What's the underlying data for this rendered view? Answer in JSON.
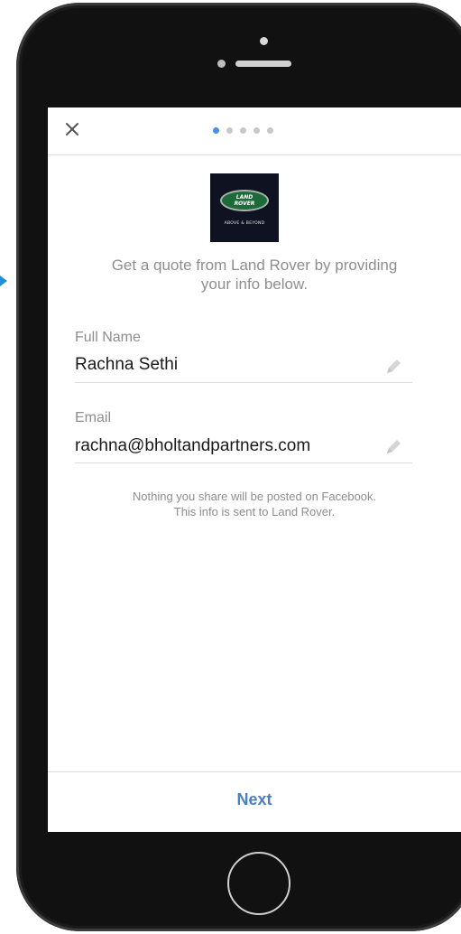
{
  "form": {
    "logo_alt": "LAND ROVER",
    "logo_wordmark_line1": "LAND",
    "logo_wordmark_line2": "ROVER",
    "logo_tagline": "ABOVE & BEYOND",
    "intro_line1": "Get a quote from Land Rover by providing",
    "intro_line2": "your info below.",
    "fields": [
      {
        "label": "Full Name",
        "value": "Rachna Sethi"
      },
      {
        "label": "Email",
        "value": "rachna@bholtandpartners.com"
      }
    ],
    "privacy_line1": "Nothing you share will be posted on Facebook.",
    "privacy_line2": "This info is sent to Land Rover.",
    "next_label": "Next"
  },
  "progress": {
    "total_steps": 5,
    "current_step": 1
  },
  "icons": {
    "close": "close-icon",
    "edit": "pencil-icon"
  },
  "colors": {
    "accent": "#4a7fc1",
    "active_dot": "#4a90e2",
    "muted_text": "#8e8e8e",
    "land_rover_green": "#1e6b3a",
    "pointer_arrow": "#1f8fd6"
  }
}
